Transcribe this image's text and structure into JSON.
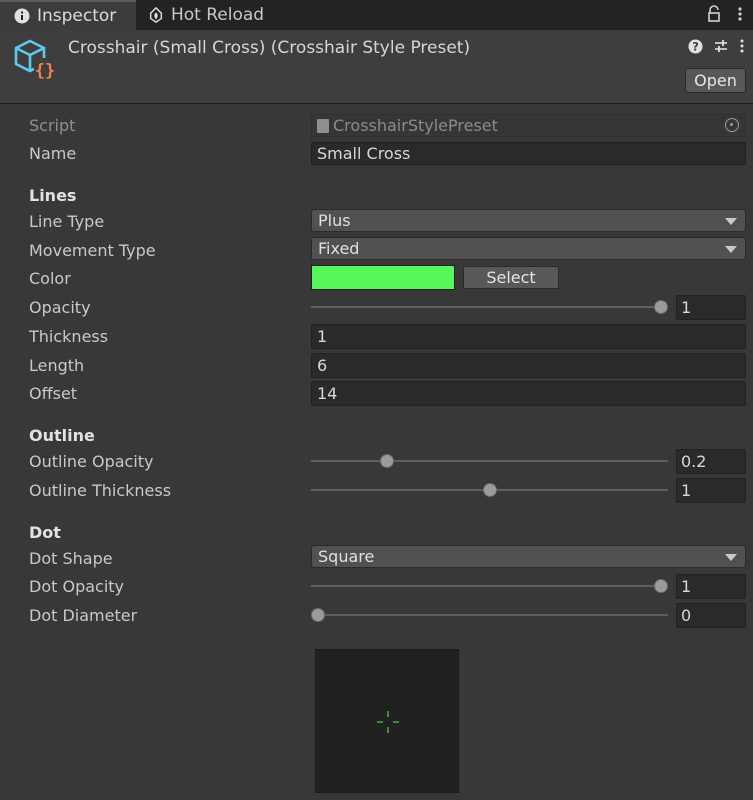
{
  "tabs": [
    {
      "label": "Inspector",
      "icon": "info-icon",
      "active": true
    },
    {
      "label": "Hot Reload",
      "icon": "flame-icon",
      "active": false
    }
  ],
  "header": {
    "title": "Crosshair (Small Cross) (Crosshair Style Preset)",
    "open_label": "Open",
    "asset_icon": "scriptable-object-icon"
  },
  "fields": {
    "script": {
      "label": "Script",
      "value": "CrosshairStylePreset"
    },
    "name": {
      "label": "Name",
      "value": "Small Cross"
    }
  },
  "sections": {
    "lines": {
      "title": "Lines",
      "line_type": {
        "label": "Line Type",
        "value": "Plus"
      },
      "movement_type": {
        "label": "Movement Type",
        "value": "Fixed"
      },
      "color": {
        "label": "Color",
        "value": "#56f75a",
        "select_label": "Select"
      },
      "opacity": {
        "label": "Opacity",
        "value": "1",
        "fraction": 1.0
      },
      "thickness": {
        "label": "Thickness",
        "value": "1"
      },
      "length": {
        "label": "Length",
        "value": "6"
      },
      "offset": {
        "label": "Offset",
        "value": "14"
      }
    },
    "outline": {
      "title": "Outline",
      "outline_opacity": {
        "label": "Outline Opacity",
        "value": "0.2",
        "fraction": 0.2
      },
      "outline_thickness": {
        "label": "Outline Thickness",
        "value": "1",
        "fraction": 0.5
      }
    },
    "dot": {
      "title": "Dot",
      "dot_shape": {
        "label": "Dot Shape",
        "value": "Square"
      },
      "dot_opacity": {
        "label": "Dot Opacity",
        "value": "1",
        "fraction": 1.0
      },
      "dot_diameter": {
        "label": "Dot Diameter",
        "value": "0",
        "fraction": 0.0
      }
    }
  },
  "colors": {
    "crosshair": "#56f75a",
    "background": "#383838",
    "preview_bg": "#212121"
  }
}
